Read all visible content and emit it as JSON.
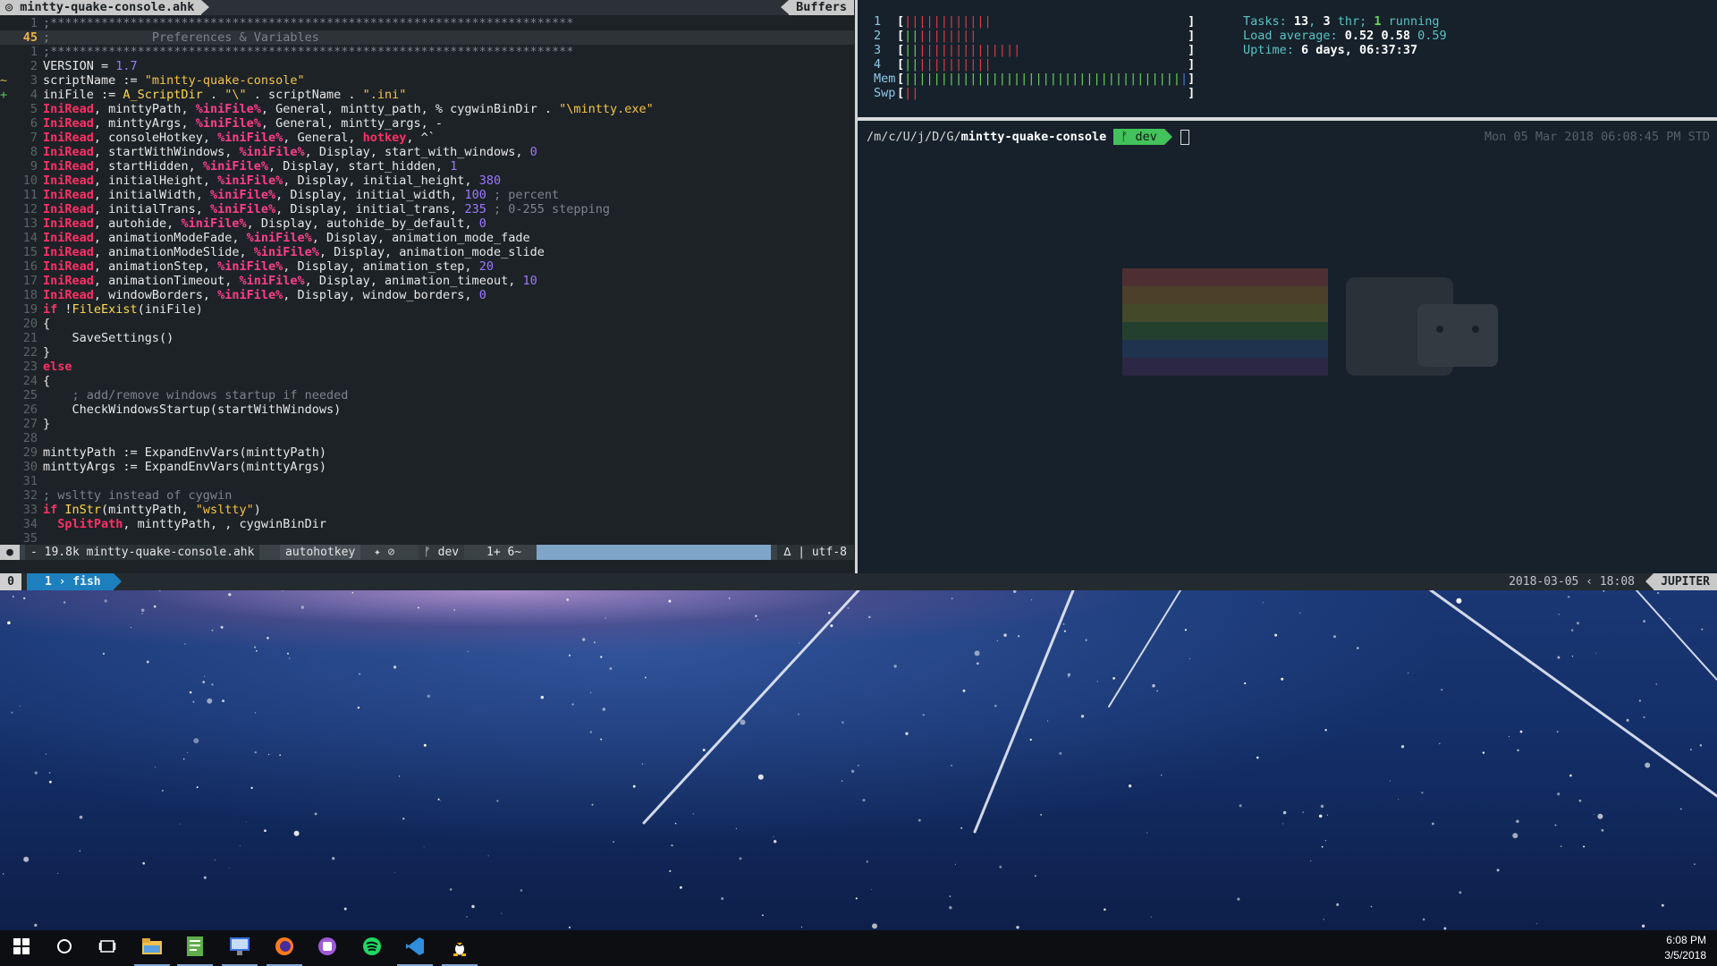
{
  "editor": {
    "tab_title": "mintty-quake-console.ahk",
    "tab_buffers": "Buffers",
    "lines": [
      {
        "gutter": "",
        "num": "1",
        "cur": false,
        "segs": [
          [
            "k-com",
            ";************************************************************************"
          ]
        ]
      },
      {
        "gutter": "",
        "num": "45",
        "cur": true,
        "segs": [
          [
            "k-com",
            ";              Preferences & Variables"
          ]
        ]
      },
      {
        "gutter": "",
        "num": "1",
        "cur": false,
        "segs": [
          [
            "k-com",
            ";************************************************************************"
          ]
        ]
      },
      {
        "gutter": "",
        "num": "2",
        "cur": false,
        "segs": [
          [
            "",
            "VERSION = "
          ],
          [
            "k-num",
            "1.7"
          ]
        ]
      },
      {
        "gutter": "~",
        "num": "3",
        "cur": false,
        "segs": [
          [
            "",
            "scriptName := "
          ],
          [
            "k-str",
            "\"mintty-quake-console\""
          ]
        ]
      },
      {
        "gutter": "+",
        "num": "4",
        "cur": false,
        "segs": [
          [
            "",
            "iniFile := "
          ],
          [
            "k-fn",
            "A_ScriptDir"
          ],
          [
            "",
            " . "
          ],
          [
            "k-str",
            "\"\\\""
          ],
          [
            "",
            " . scriptName . "
          ],
          [
            "k-str",
            "\".ini\""
          ]
        ]
      },
      {
        "gutter": "",
        "num": "5",
        "cur": false,
        "segs": [
          [
            "k-red",
            "IniRead"
          ],
          [
            "",
            ", minttyPath, "
          ],
          [
            "k-pink",
            "%iniFile%"
          ],
          [
            "",
            ", General, mintty_path, % cygwinBinDir . "
          ],
          [
            "k-str",
            "\"\\mintty.exe\""
          ]
        ]
      },
      {
        "gutter": "",
        "num": "6",
        "cur": false,
        "segs": [
          [
            "k-red",
            "IniRead"
          ],
          [
            "",
            ", minttyArgs, "
          ],
          [
            "k-pink",
            "%iniFile%"
          ],
          [
            "",
            ", General, mintty_args, -"
          ]
        ]
      },
      {
        "gutter": "",
        "num": "7",
        "cur": false,
        "segs": [
          [
            "k-red",
            "IniRead"
          ],
          [
            "",
            ", consoleHotkey, "
          ],
          [
            "k-pink",
            "%iniFile%"
          ],
          [
            "",
            ", General, "
          ],
          [
            "k-red",
            "hotkey"
          ],
          [
            "",
            ", ^`"
          ]
        ]
      },
      {
        "gutter": "",
        "num": "8",
        "cur": false,
        "segs": [
          [
            "k-red",
            "IniRead"
          ],
          [
            "",
            ", startWithWindows, "
          ],
          [
            "k-pink",
            "%iniFile%"
          ],
          [
            "",
            ", Display, start_with_windows, "
          ],
          [
            "k-num",
            "0"
          ]
        ]
      },
      {
        "gutter": "",
        "num": "9",
        "cur": false,
        "segs": [
          [
            "k-red",
            "IniRead"
          ],
          [
            "",
            ", startHidden, "
          ],
          [
            "k-pink",
            "%iniFile%"
          ],
          [
            "",
            ", Display, start_hidden, "
          ],
          [
            "k-num",
            "1"
          ]
        ]
      },
      {
        "gutter": "",
        "num": "10",
        "cur": false,
        "segs": [
          [
            "k-red",
            "IniRead"
          ],
          [
            "",
            ", initialHeight, "
          ],
          [
            "k-pink",
            "%iniFile%"
          ],
          [
            "",
            ", Display, initial_height, "
          ],
          [
            "k-num",
            "380"
          ]
        ]
      },
      {
        "gutter": "",
        "num": "11",
        "cur": false,
        "segs": [
          [
            "k-red",
            "IniRead"
          ],
          [
            "",
            ", initialWidth, "
          ],
          [
            "k-pink",
            "%iniFile%"
          ],
          [
            "",
            ", Display, initial_width, "
          ],
          [
            "k-num",
            "100"
          ],
          [
            "k-com",
            " ; percent"
          ]
        ]
      },
      {
        "gutter": "",
        "num": "12",
        "cur": false,
        "segs": [
          [
            "k-red",
            "IniRead"
          ],
          [
            "",
            ", initialTrans, "
          ],
          [
            "k-pink",
            "%iniFile%"
          ],
          [
            "",
            ", Display, initial_trans, "
          ],
          [
            "k-num",
            "235"
          ],
          [
            "k-com",
            " ; 0-255 stepping"
          ]
        ]
      },
      {
        "gutter": "",
        "num": "13",
        "cur": false,
        "segs": [
          [
            "k-red",
            "IniRead"
          ],
          [
            "",
            ", autohide, "
          ],
          [
            "k-pink",
            "%iniFile%"
          ],
          [
            "",
            ", Display, autohide_by_default, "
          ],
          [
            "k-num",
            "0"
          ]
        ]
      },
      {
        "gutter": "",
        "num": "14",
        "cur": false,
        "segs": [
          [
            "k-red",
            "IniRead"
          ],
          [
            "",
            ", animationModeFade, "
          ],
          [
            "k-pink",
            "%iniFile%"
          ],
          [
            "",
            ", Display, animation_mode_fade"
          ]
        ]
      },
      {
        "gutter": "",
        "num": "15",
        "cur": false,
        "segs": [
          [
            "k-red",
            "IniRead"
          ],
          [
            "",
            ", animationModeSlide, "
          ],
          [
            "k-pink",
            "%iniFile%"
          ],
          [
            "",
            ", Display, animation_mode_slide"
          ]
        ]
      },
      {
        "gutter": "",
        "num": "16",
        "cur": false,
        "segs": [
          [
            "k-red",
            "IniRead"
          ],
          [
            "",
            ", animationStep, "
          ],
          [
            "k-pink",
            "%iniFile%"
          ],
          [
            "",
            ", Display, animation_step, "
          ],
          [
            "k-num",
            "20"
          ]
        ]
      },
      {
        "gutter": "",
        "num": "17",
        "cur": false,
        "segs": [
          [
            "k-red",
            "IniRead"
          ],
          [
            "",
            ", animationTimeout, "
          ],
          [
            "k-pink",
            "%iniFile%"
          ],
          [
            "",
            ", Display, animation_timeout, "
          ],
          [
            "k-num",
            "10"
          ]
        ]
      },
      {
        "gutter": "",
        "num": "18",
        "cur": false,
        "segs": [
          [
            "k-red",
            "IniRead"
          ],
          [
            "",
            ", windowBorders, "
          ],
          [
            "k-pink",
            "%iniFile%"
          ],
          [
            "",
            ", Display, window_borders, "
          ],
          [
            "k-num",
            "0"
          ]
        ]
      },
      {
        "gutter": "",
        "num": "19",
        "cur": false,
        "segs": [
          [
            "k-red",
            "if"
          ],
          [
            "",
            " !"
          ],
          [
            "k-fn",
            "FileExist"
          ],
          [
            "",
            "(iniFile)"
          ]
        ]
      },
      {
        "gutter": "",
        "num": "20",
        "cur": false,
        "segs": [
          [
            "",
            "{"
          ]
        ]
      },
      {
        "gutter": "",
        "num": "21",
        "cur": false,
        "segs": [
          [
            "",
            "    SaveSettings()"
          ]
        ]
      },
      {
        "gutter": "",
        "num": "22",
        "cur": false,
        "segs": [
          [
            "",
            "}"
          ]
        ]
      },
      {
        "gutter": "",
        "num": "23",
        "cur": false,
        "segs": [
          [
            "k-red",
            "else"
          ]
        ]
      },
      {
        "gutter": "",
        "num": "24",
        "cur": false,
        "segs": [
          [
            "",
            "{"
          ]
        ]
      },
      {
        "gutter": "",
        "num": "25",
        "cur": false,
        "segs": [
          [
            "k-com",
            "    ; add/remove windows startup if needed"
          ]
        ]
      },
      {
        "gutter": "",
        "num": "26",
        "cur": false,
        "segs": [
          [
            "",
            "    CheckWindowsStartup(startWithWindows)"
          ]
        ]
      },
      {
        "gutter": "",
        "num": "27",
        "cur": false,
        "segs": [
          [
            "",
            "}"
          ]
        ]
      },
      {
        "gutter": "",
        "num": "28",
        "cur": false,
        "segs": [
          [
            "",
            ""
          ]
        ]
      },
      {
        "gutter": "",
        "num": "29",
        "cur": false,
        "segs": [
          [
            "",
            "minttyPath := ExpandEnvVars(minttyPath)"
          ]
        ]
      },
      {
        "gutter": "",
        "num": "30",
        "cur": false,
        "segs": [
          [
            "",
            "minttyArgs := ExpandEnvVars(minttyArgs)"
          ]
        ]
      },
      {
        "gutter": "",
        "num": "31",
        "cur": false,
        "segs": [
          [
            "",
            ""
          ]
        ]
      },
      {
        "gutter": "",
        "num": "32",
        "cur": false,
        "segs": [
          [
            "k-com",
            "; wsltty instead of cygwin"
          ]
        ]
      },
      {
        "gutter": "",
        "num": "33",
        "cur": false,
        "segs": [
          [
            "k-red",
            "if"
          ],
          [
            "",
            " "
          ],
          [
            "k-fn",
            "InStr"
          ],
          [
            "",
            "(minttyPath, "
          ],
          [
            "k-str",
            "\"wsltty\""
          ],
          [
            "",
            ")"
          ]
        ]
      },
      {
        "gutter": "",
        "num": "34",
        "cur": false,
        "segs": [
          [
            "",
            "  "
          ],
          [
            "k-red",
            "SplitPath"
          ],
          [
            "",
            ", minttyPath, , cygwinBinDir"
          ]
        ]
      },
      {
        "gutter": "",
        "num": "35",
        "cur": false,
        "segs": [
          [
            "",
            ""
          ]
        ]
      }
    ],
    "status": {
      "mode": "●",
      "file": "- 19.8k mintty-quake-console.ahk",
      "filetype": "autohotkey",
      "lsp": "✦ ⊘",
      "branch": "ᚠ dev",
      "position": "1+ 6~",
      "encoding": "∆ | utf-8"
    }
  },
  "htop": {
    "cpus": [
      {
        "label": "1",
        "red": 12,
        "green": 0,
        "blue": 0
      },
      {
        "label": "2",
        "red": 8,
        "green": 2,
        "blue": 0
      },
      {
        "label": "3",
        "red": 14,
        "green": 2,
        "blue": 0
      },
      {
        "label": "4",
        "red": 10,
        "green": 2,
        "blue": 0
      }
    ],
    "mem_label": "Mem",
    "mem_bar_green": 38,
    "mem_bar_blue": 1,
    "swp_label": "Swp",
    "swp_bar_red": 2,
    "tasks_label": "Tasks: ",
    "tasks_count": "13",
    "tasks_sep": ", ",
    "threads_count": "3",
    "threads_label": " thr; ",
    "running_count": "1",
    "running_label": " running",
    "load_label": "Load average: ",
    "load_1": "0.52",
    "load_5": "0.58",
    "load_15": "0.59",
    "uptime_label": "Uptime: ",
    "uptime_value": "6 days, 06:37:37"
  },
  "prompt": {
    "path_prefix": "/m/c/U/j/D/G/",
    "path_dir": "mintty-quake-console",
    "branch": "ᚠ dev",
    "time": "Mon 05 Mar 2018 06:08:45 PM STD"
  },
  "tmux": {
    "session": "0",
    "window_index": "1",
    "window_name": "fish",
    "date": "2018-03-05",
    "time": "18:08",
    "host": "JUPITER"
  },
  "taskbar": {
    "apps": [
      {
        "name": "start-button",
        "icon": "windows-logo-icon",
        "active": false
      },
      {
        "name": "search-button",
        "icon": "cortana-circle-icon",
        "active": false
      },
      {
        "name": "task-view-button",
        "icon": "task-view-icon",
        "active": false
      },
      {
        "name": "file-explorer-button",
        "icon": "folder-icon",
        "active": true
      },
      {
        "name": "notepad-button",
        "icon": "notepad-icon",
        "active": true
      },
      {
        "name": "remote-app-button",
        "icon": "remote-desktop-icon",
        "active": true
      },
      {
        "name": "firefox-button",
        "icon": "firefox-icon",
        "active": true
      },
      {
        "name": "tor-button",
        "icon": "purple-app-icon",
        "active": false
      },
      {
        "name": "spotify-button",
        "icon": "spotify-icon",
        "active": false
      },
      {
        "name": "vscode-button",
        "icon": "vscode-icon",
        "active": true
      },
      {
        "name": "terminal-button",
        "icon": "penguin-icon",
        "active": true
      }
    ],
    "clock_time": "6:08 PM",
    "clock_date": "3/5/2018"
  }
}
